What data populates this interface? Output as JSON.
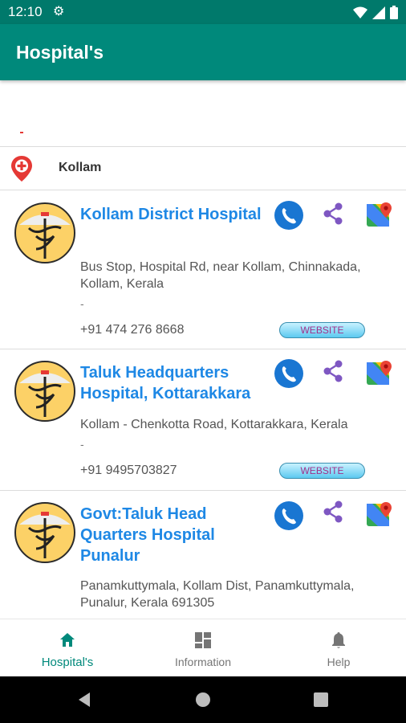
{
  "status_bar": {
    "time": "12:10"
  },
  "app_bar": {
    "title": "Hospital's"
  },
  "location": {
    "label": "Kollam"
  },
  "hospitals": [
    {
      "name": "Kollam District Hospital",
      "address": " Bus Stop, Hospital Rd, near Kollam, Chinnakada, Kollam, Kerala",
      "extra": "-",
      "phone": "+91 474 276 8668",
      "website_label": "WEBSITE"
    },
    {
      "name": "Taluk Headquarters Hospital, Kottarakkara",
      "address": " Kollam - Chenkotta Road, Kottarakkara, Kerala",
      "extra": "-",
      "phone": "+91 9495703827",
      "website_label": "WEBSITE"
    },
    {
      "name": "Govt:Taluk Head Quarters Hospital Punalur",
      "address": " Panamkuttymala, Kollam Dist, Panamkuttymala, Punalur, Kerala 691305",
      "extra": "",
      "phone": "",
      "website_label": ""
    }
  ],
  "bottom_nav": [
    {
      "label": "Hospital's",
      "icon": "home-icon",
      "active": true
    },
    {
      "label": "Information",
      "icon": "dashboard-icon",
      "active": false
    },
    {
      "label": "Help",
      "icon": "bell-icon",
      "active": false
    }
  ],
  "colors": {
    "status_bar": "#00796b",
    "app_bar": "#00897b",
    "link_blue": "#1e88e5",
    "active_nav": "#00897b",
    "call_blue": "#1976d2",
    "share_purple": "#7e57c2"
  }
}
